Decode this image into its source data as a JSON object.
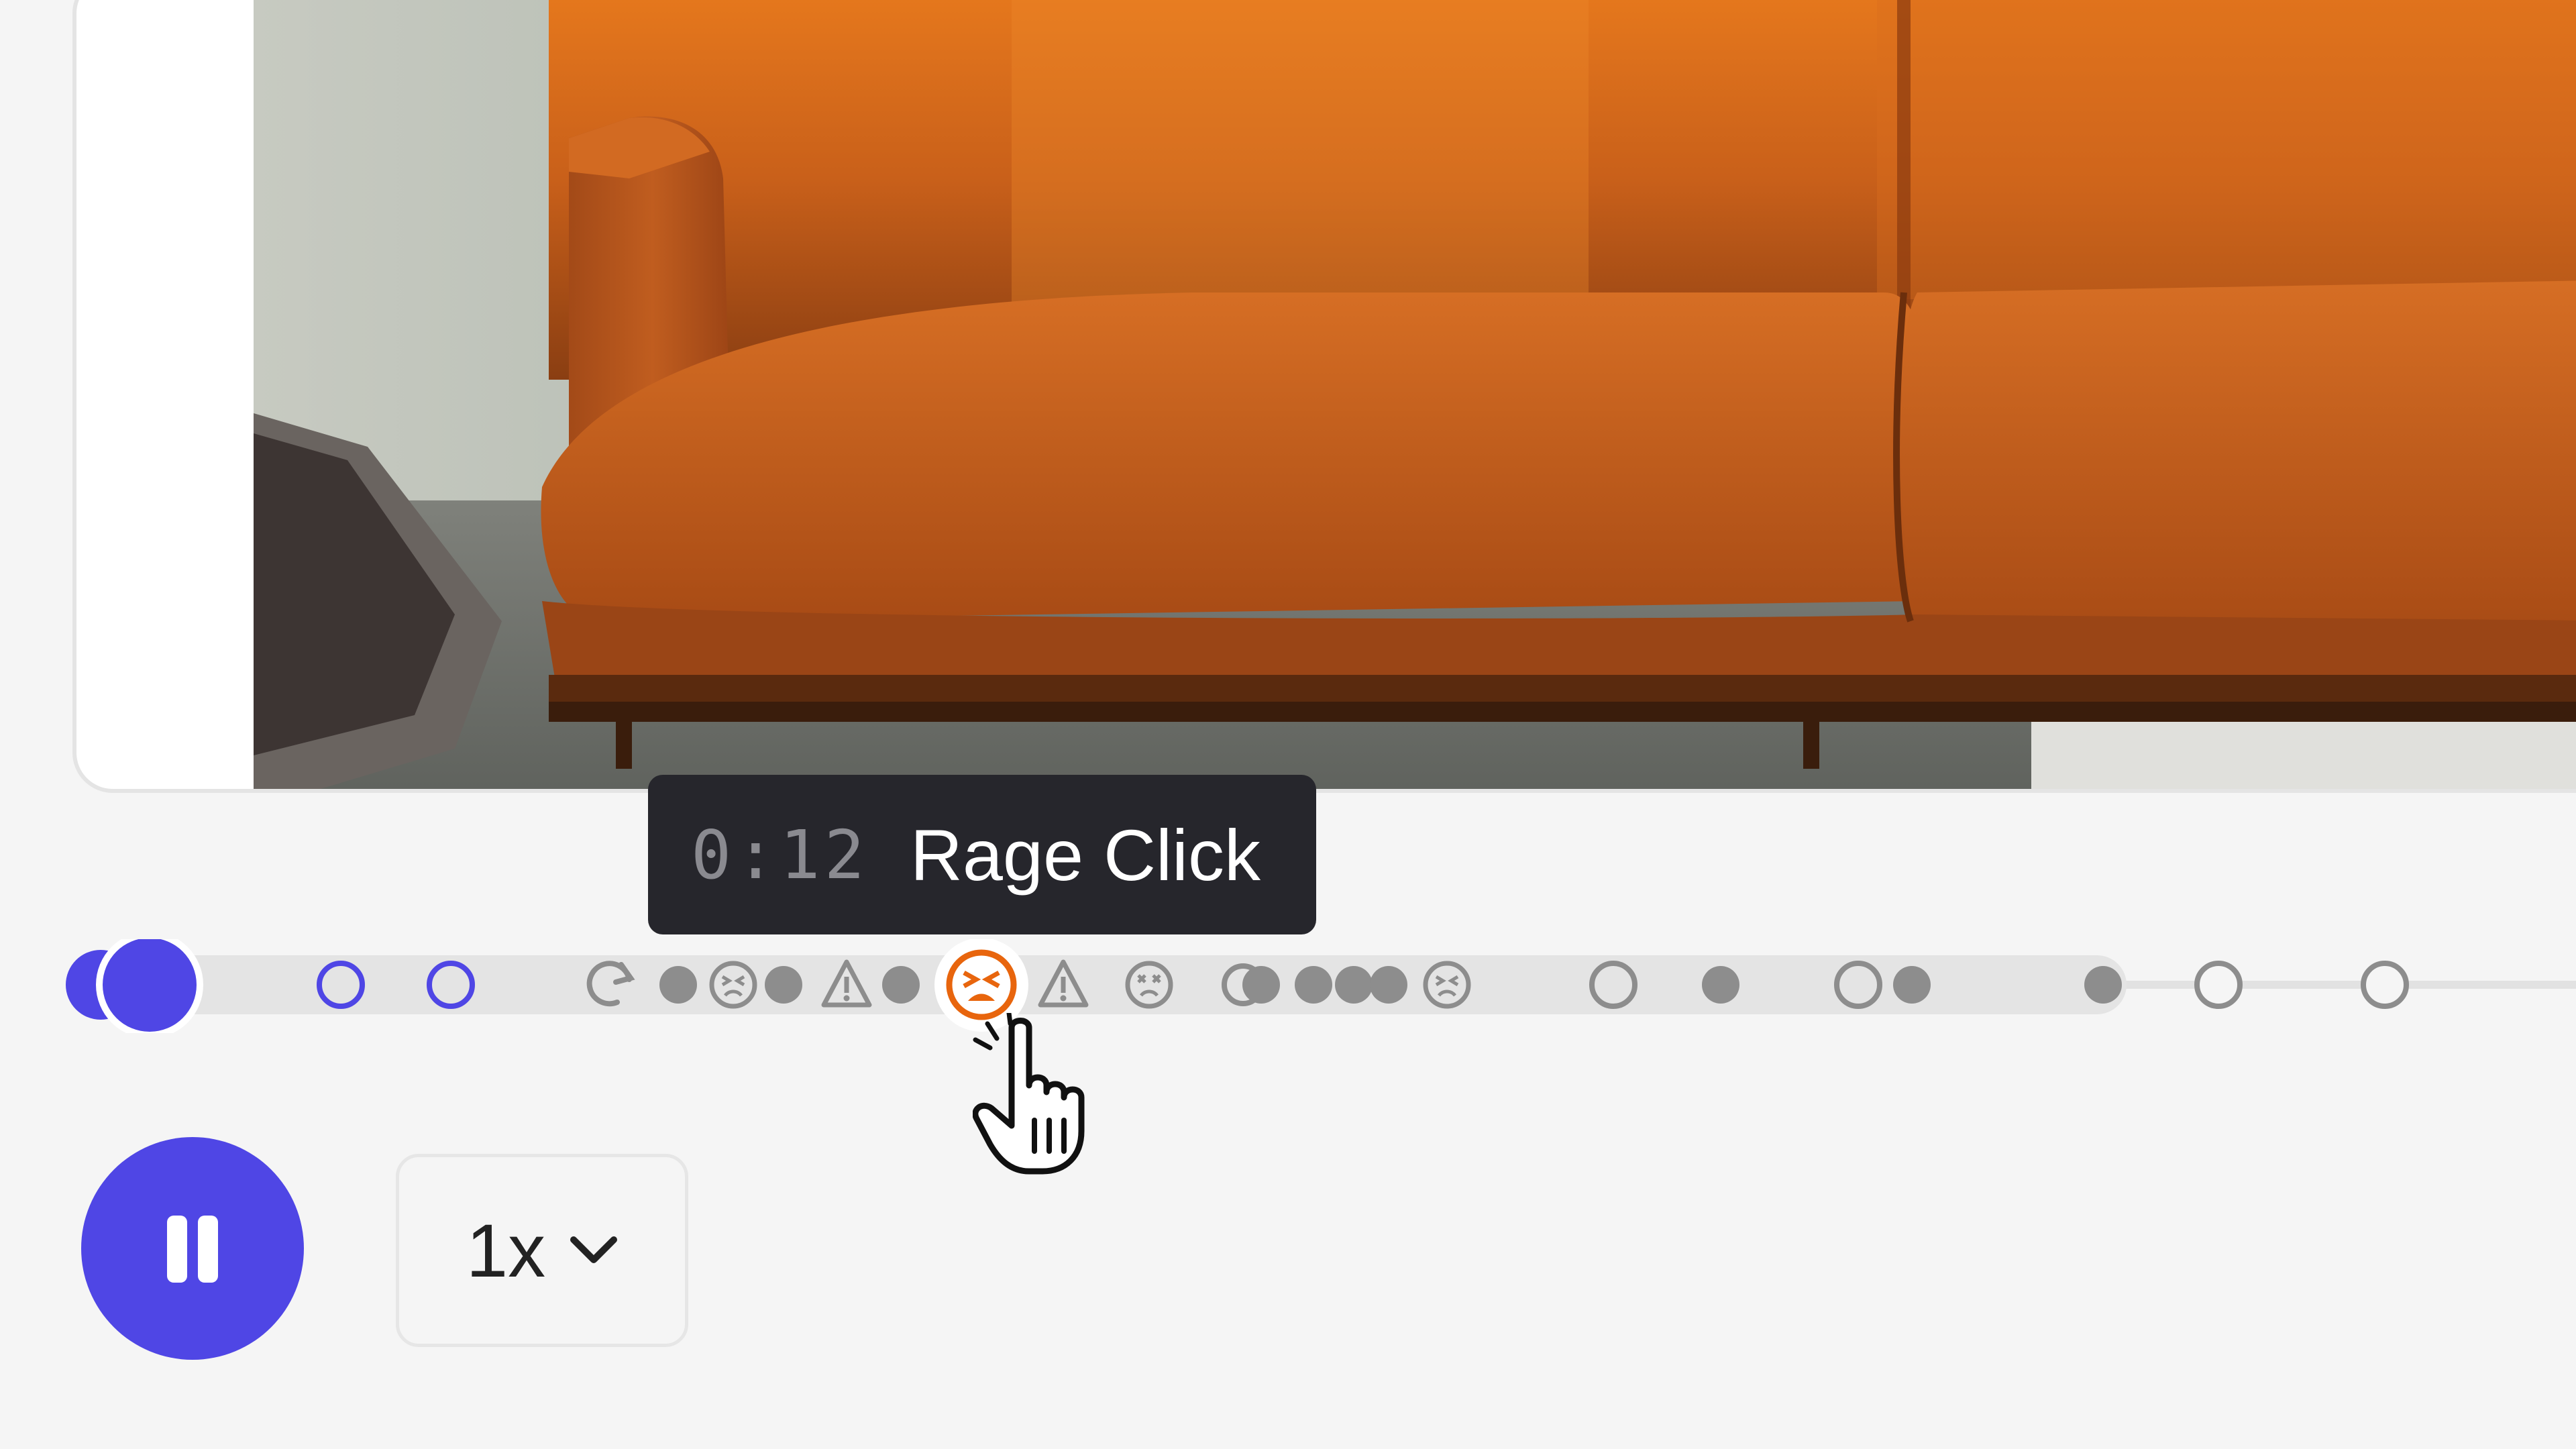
{
  "player": {
    "tooltip": {
      "timestamp": "0:12",
      "event_label": "Rage Click"
    },
    "speed": {
      "value": "1x"
    },
    "state": "playing",
    "accent_color": "#4f46e5",
    "highlight_color": "#e8650d"
  },
  "timeline": {
    "events": [
      "rage-click-icon",
      "refresh-icon",
      "dead-click-icon",
      "error-warning-icon",
      "circle-marker",
      "dot-marker"
    ]
  }
}
